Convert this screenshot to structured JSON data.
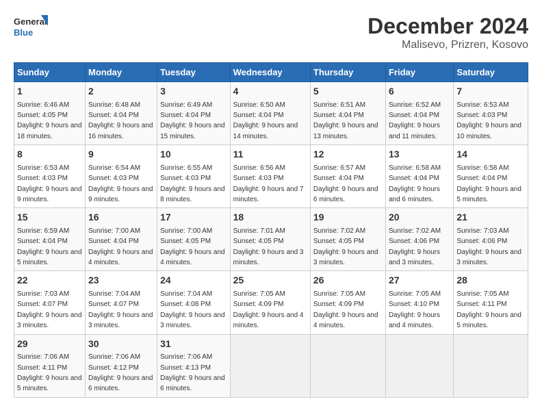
{
  "logo": {
    "text_general": "General",
    "text_blue": "Blue"
  },
  "title": "December 2024",
  "subtitle": "Malisevo, Prizren, Kosovo",
  "days_of_week": [
    "Sunday",
    "Monday",
    "Tuesday",
    "Wednesday",
    "Thursday",
    "Friday",
    "Saturday"
  ],
  "weeks": [
    [
      {
        "day": "1",
        "sunrise": "Sunrise: 6:46 AM",
        "sunset": "Sunset: 4:05 PM",
        "daylight": "Daylight: 9 hours and 18 minutes."
      },
      {
        "day": "2",
        "sunrise": "Sunrise: 6:48 AM",
        "sunset": "Sunset: 4:04 PM",
        "daylight": "Daylight: 9 hours and 16 minutes."
      },
      {
        "day": "3",
        "sunrise": "Sunrise: 6:49 AM",
        "sunset": "Sunset: 4:04 PM",
        "daylight": "Daylight: 9 hours and 15 minutes."
      },
      {
        "day": "4",
        "sunrise": "Sunrise: 6:50 AM",
        "sunset": "Sunset: 4:04 PM",
        "daylight": "Daylight: 9 hours and 14 minutes."
      },
      {
        "day": "5",
        "sunrise": "Sunrise: 6:51 AM",
        "sunset": "Sunset: 4:04 PM",
        "daylight": "Daylight: 9 hours and 13 minutes."
      },
      {
        "day": "6",
        "sunrise": "Sunrise: 6:52 AM",
        "sunset": "Sunset: 4:04 PM",
        "daylight": "Daylight: 9 hours and 11 minutes."
      },
      {
        "day": "7",
        "sunrise": "Sunrise: 6:53 AM",
        "sunset": "Sunset: 4:03 PM",
        "daylight": "Daylight: 9 hours and 10 minutes."
      }
    ],
    [
      {
        "day": "8",
        "sunrise": "Sunrise: 6:53 AM",
        "sunset": "Sunset: 4:03 PM",
        "daylight": "Daylight: 9 hours and 9 minutes."
      },
      {
        "day": "9",
        "sunrise": "Sunrise: 6:54 AM",
        "sunset": "Sunset: 4:03 PM",
        "daylight": "Daylight: 9 hours and 9 minutes."
      },
      {
        "day": "10",
        "sunrise": "Sunrise: 6:55 AM",
        "sunset": "Sunset: 4:03 PM",
        "daylight": "Daylight: 9 hours and 8 minutes."
      },
      {
        "day": "11",
        "sunrise": "Sunrise: 6:56 AM",
        "sunset": "Sunset: 4:03 PM",
        "daylight": "Daylight: 9 hours and 7 minutes."
      },
      {
        "day": "12",
        "sunrise": "Sunrise: 6:57 AM",
        "sunset": "Sunset: 4:04 PM",
        "daylight": "Daylight: 9 hours and 6 minutes."
      },
      {
        "day": "13",
        "sunrise": "Sunrise: 6:58 AM",
        "sunset": "Sunset: 4:04 PM",
        "daylight": "Daylight: 9 hours and 6 minutes."
      },
      {
        "day": "14",
        "sunrise": "Sunrise: 6:58 AM",
        "sunset": "Sunset: 4:04 PM",
        "daylight": "Daylight: 9 hours and 5 minutes."
      }
    ],
    [
      {
        "day": "15",
        "sunrise": "Sunrise: 6:59 AM",
        "sunset": "Sunset: 4:04 PM",
        "daylight": "Daylight: 9 hours and 5 minutes."
      },
      {
        "day": "16",
        "sunrise": "Sunrise: 7:00 AM",
        "sunset": "Sunset: 4:04 PM",
        "daylight": "Daylight: 9 hours and 4 minutes."
      },
      {
        "day": "17",
        "sunrise": "Sunrise: 7:00 AM",
        "sunset": "Sunset: 4:05 PM",
        "daylight": "Daylight: 9 hours and 4 minutes."
      },
      {
        "day": "18",
        "sunrise": "Sunrise: 7:01 AM",
        "sunset": "Sunset: 4:05 PM",
        "daylight": "Daylight: 9 hours and 3 minutes."
      },
      {
        "day": "19",
        "sunrise": "Sunrise: 7:02 AM",
        "sunset": "Sunset: 4:05 PM",
        "daylight": "Daylight: 9 hours and 3 minutes."
      },
      {
        "day": "20",
        "sunrise": "Sunrise: 7:02 AM",
        "sunset": "Sunset: 4:06 PM",
        "daylight": "Daylight: 9 hours and 3 minutes."
      },
      {
        "day": "21",
        "sunrise": "Sunrise: 7:03 AM",
        "sunset": "Sunset: 4:06 PM",
        "daylight": "Daylight: 9 hours and 3 minutes."
      }
    ],
    [
      {
        "day": "22",
        "sunrise": "Sunrise: 7:03 AM",
        "sunset": "Sunset: 4:07 PM",
        "daylight": "Daylight: 9 hours and 3 minutes."
      },
      {
        "day": "23",
        "sunrise": "Sunrise: 7:04 AM",
        "sunset": "Sunset: 4:07 PM",
        "daylight": "Daylight: 9 hours and 3 minutes."
      },
      {
        "day": "24",
        "sunrise": "Sunrise: 7:04 AM",
        "sunset": "Sunset: 4:08 PM",
        "daylight": "Daylight: 9 hours and 3 minutes."
      },
      {
        "day": "25",
        "sunrise": "Sunrise: 7:05 AM",
        "sunset": "Sunset: 4:09 PM",
        "daylight": "Daylight: 9 hours and 4 minutes."
      },
      {
        "day": "26",
        "sunrise": "Sunrise: 7:05 AM",
        "sunset": "Sunset: 4:09 PM",
        "daylight": "Daylight: 9 hours and 4 minutes."
      },
      {
        "day": "27",
        "sunrise": "Sunrise: 7:05 AM",
        "sunset": "Sunset: 4:10 PM",
        "daylight": "Daylight: 9 hours and 4 minutes."
      },
      {
        "day": "28",
        "sunrise": "Sunrise: 7:05 AM",
        "sunset": "Sunset: 4:11 PM",
        "daylight": "Daylight: 9 hours and 5 minutes."
      }
    ],
    [
      {
        "day": "29",
        "sunrise": "Sunrise: 7:06 AM",
        "sunset": "Sunset: 4:11 PM",
        "daylight": "Daylight: 9 hours and 5 minutes."
      },
      {
        "day": "30",
        "sunrise": "Sunrise: 7:06 AM",
        "sunset": "Sunset: 4:12 PM",
        "daylight": "Daylight: 9 hours and 6 minutes."
      },
      {
        "day": "31",
        "sunrise": "Sunrise: 7:06 AM",
        "sunset": "Sunset: 4:13 PM",
        "daylight": "Daylight: 9 hours and 6 minutes."
      },
      null,
      null,
      null,
      null
    ]
  ]
}
